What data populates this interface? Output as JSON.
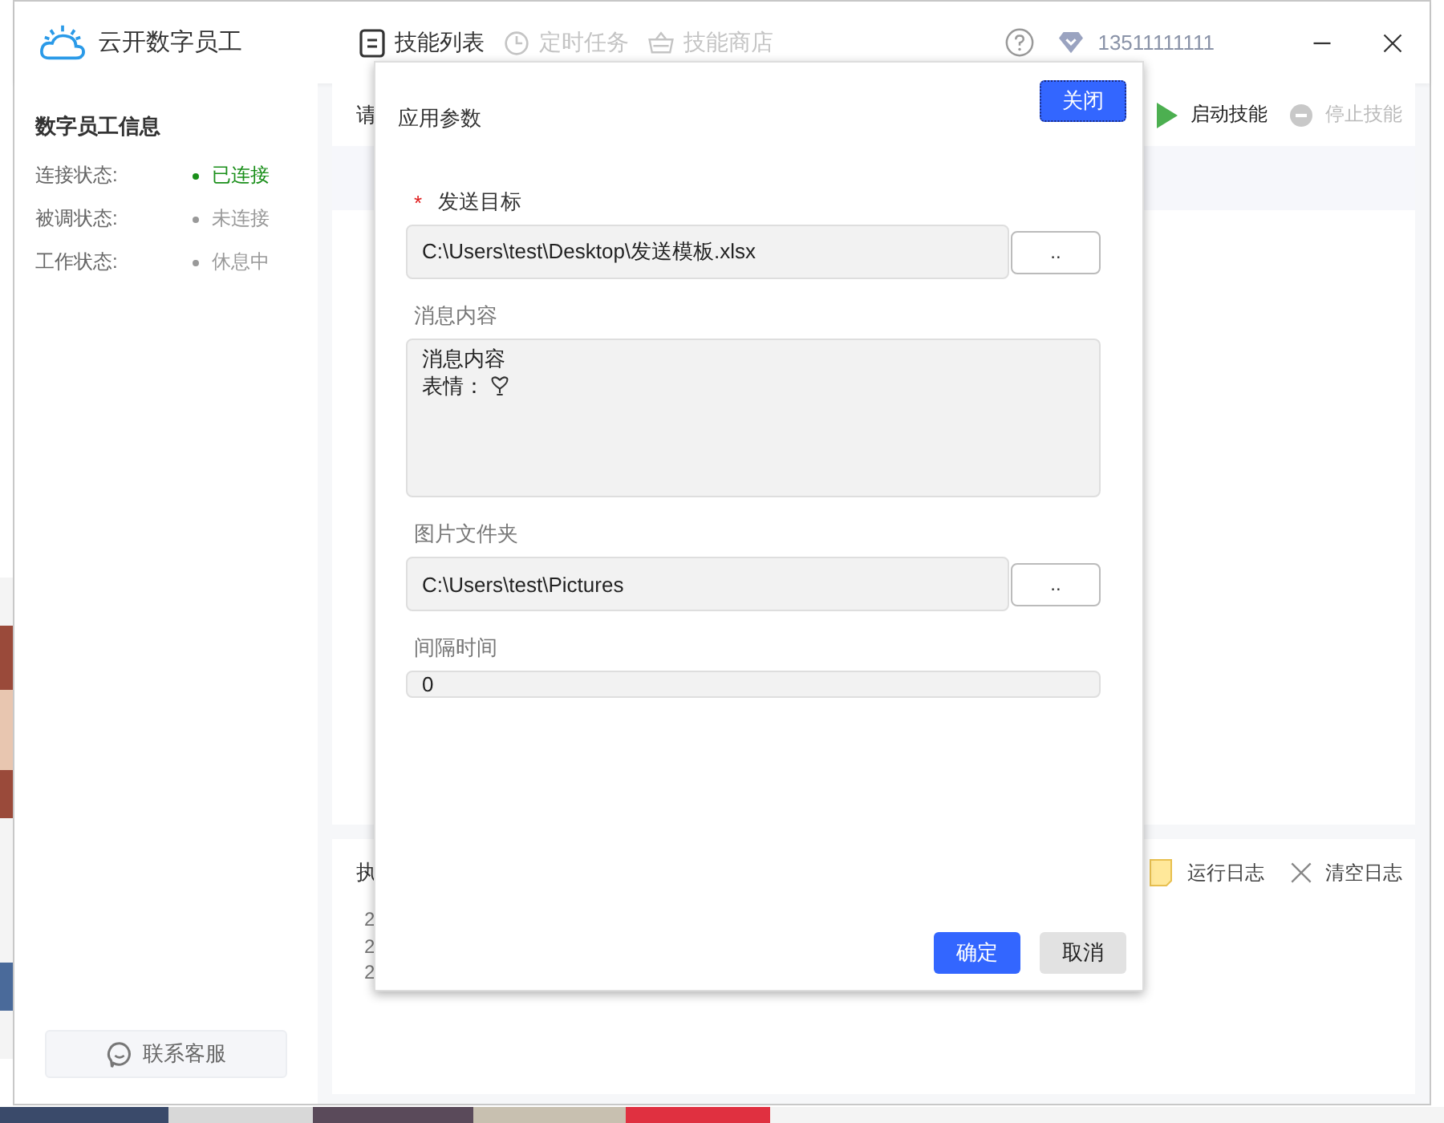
{
  "app": {
    "title": "云开数字员工"
  },
  "nav_tabs": [
    {
      "label": "技能列表",
      "selected": true,
      "kind": "list"
    },
    {
      "label": "定时任务",
      "selected": false,
      "kind": "clock"
    },
    {
      "label": "技能商店",
      "selected": false,
      "kind": "store"
    }
  ],
  "account": {
    "phone": "13511111111"
  },
  "sidebar": {
    "title": "数字员工信息",
    "items": [
      {
        "label": "连接状态:",
        "value": "已连接",
        "color": "#1a8f1a"
      },
      {
        "label": "被调状态:",
        "value": "未连接",
        "color": "#999999"
      },
      {
        "label": "工作状态:",
        "value": "休息中",
        "color": "#999999"
      }
    ],
    "contact_button": "联系客服"
  },
  "skills_panel": {
    "prompt": "请",
    "actions": [
      {
        "label": "启动技能",
        "kind": "start",
        "disabled": false
      },
      {
        "label": "停止技能",
        "kind": "stop",
        "disabled": true
      }
    ]
  },
  "log_panel": {
    "title": "执",
    "actions": [
      {
        "label": "运行日志",
        "kind": "folder"
      },
      {
        "label": "清空日志",
        "kind": "clear"
      }
    ],
    "lines": [
      "2",
      "2",
      "2"
    ]
  },
  "dialog": {
    "title": "应用参数",
    "close_button": "关闭",
    "fields": [
      {
        "kind": "file",
        "label": "发送目标",
        "required_mark": "*",
        "value": "C:\\Users\\test\\Desktop\\发送模板.xlsx",
        "browse": ".."
      },
      {
        "kind": "textarea",
        "label": "消息内容",
        "lines": [
          "消息内容",
          "表情："
        ]
      },
      {
        "kind": "file",
        "label": "图片文件夹",
        "value": "C:\\Users\\test\\Pictures",
        "browse": ".."
      },
      {
        "kind": "text",
        "label": "间隔时间",
        "value": "0"
      }
    ],
    "ok_button": "确定",
    "cancel_button": "取消"
  }
}
